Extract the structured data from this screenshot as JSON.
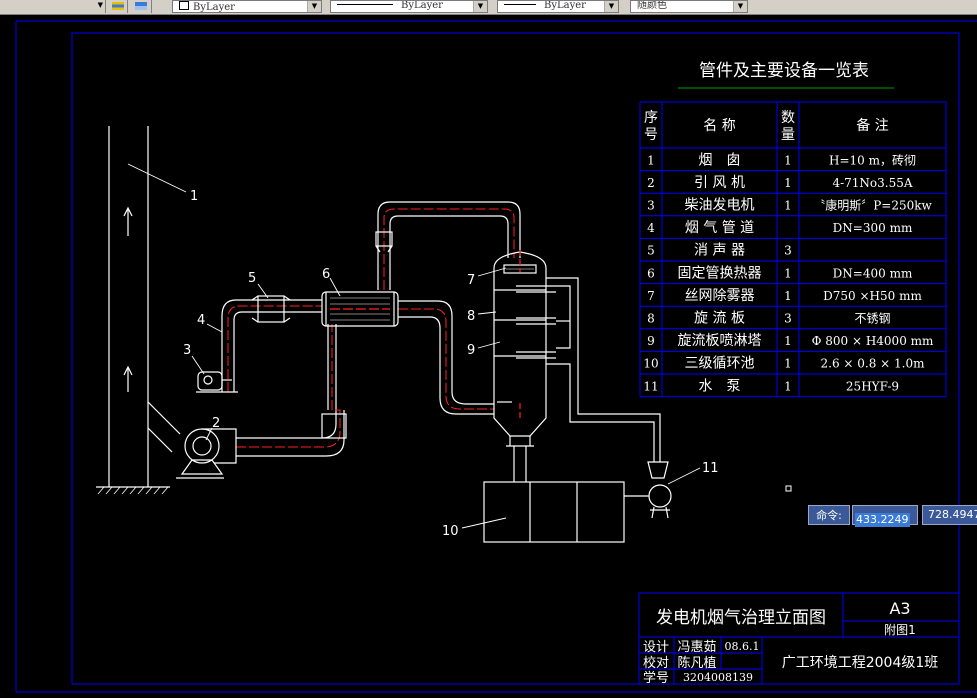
{
  "toolbar": {
    "layer_combo": "ByLayer",
    "linetype_combo": "ByLayer",
    "lineweight_combo": "ByLayer",
    "plotstyle_combo": "随颜色"
  },
  "drawing": {
    "equipment_table": {
      "title": "管件及主要设备一览表",
      "headers": [
        "序号",
        "名  称",
        "数量",
        "备  注"
      ],
      "rows": [
        [
          "1",
          "烟　囱",
          "1",
          "H=10 m，砖彻"
        ],
        [
          "2",
          "引 风 机",
          "1",
          "4-71No3.55A"
        ],
        [
          "3",
          "柴油发电机",
          "1",
          "〝康明斯〞P=250kw"
        ],
        [
          "4",
          "烟 气 管 道",
          "",
          "DN=300 mm"
        ],
        [
          "5",
          "消 声 器",
          "3",
          ""
        ],
        [
          "6",
          "固定管换热器",
          "1",
          "DN=400 mm"
        ],
        [
          "7",
          "丝网除雾器",
          "1",
          "D750 ×H50 mm"
        ],
        [
          "8",
          "旋 流 板",
          "3",
          "不锈钢"
        ],
        [
          "9",
          "旋流板喷淋塔",
          "1",
          "Φ 800 × H4000 mm"
        ],
        [
          "10",
          "三级循环池",
          "1",
          "2.6 × 0.8 × 1.0m"
        ],
        [
          "11",
          "水　泵",
          "1",
          "25HYF-9"
        ]
      ]
    },
    "callouts": [
      "1",
      "2",
      "3",
      "4",
      "5",
      "6",
      "7",
      "8",
      "9",
      "10",
      "11"
    ],
    "title_block": {
      "drawing_title": "发电机烟气治理立面图",
      "sheet_size": "A3",
      "sheet_ref": "附图1",
      "design_label": "设计",
      "design_name": "冯惠茹",
      "design_date": "08.6.1",
      "check_label": "校对",
      "check_name": "陈凡植",
      "student_label": "学号",
      "student_id": "3204008139",
      "class_name": "广工环境工程2004级1班"
    }
  },
  "command": {
    "label": "命令:",
    "x_value": "433.2249",
    "y_value": "728.4947"
  },
  "colors": {
    "background": "#000000",
    "frame": "#0000ff",
    "line": "#ffffff",
    "pipe_center": "#ff0000",
    "title_underline": "#00a000",
    "command_bg": "#3b5998"
  }
}
